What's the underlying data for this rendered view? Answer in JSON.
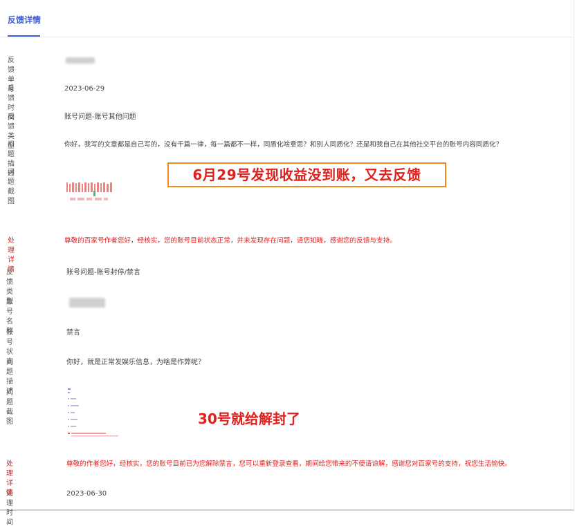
{
  "tab": {
    "label": "反馈详情"
  },
  "record1": {
    "id_label": "反馈单号",
    "time_label": "反馈时间",
    "time_value": "2023-06-29",
    "type_label": "反馈类型",
    "type_value": "账号问题-账号其他问题",
    "desc_label": "问题描述",
    "desc_value": "你好，我写的文章都是自己写的，没有千篇一律，每一篇都不一样，同质化啥意思？和别人同质化？还是和我自己在其他社交平台的账号内容同质化？",
    "screenshot_label": "问题截图",
    "detail_label": "处理详情",
    "detail_value": "尊敬的百家号作者您好，经核实，您的账号目前状态正常，并未发现存在问题，请您知晓，感谢您的反馈与支持。"
  },
  "record2": {
    "type_label": "反馈类型",
    "type_value": "账号问题-账号封停/禁言",
    "account_label": "账号名称",
    "status_label": "账号状态",
    "status_value": "禁言",
    "desc_label": "问题描述",
    "desc_value": "你好，就是正常发娱乐信息，为啥是作弊呢？",
    "screenshot_label": "问题截图",
    "detail_label": "处理详情",
    "detail_value": "尊敬的作者您好，经核实，您的账号目前已为您解除禁言，您可以重新登录查看，期间给您带来的不便请谅解，感谢您对百家号的支持，祝您生活愉快。",
    "processed_label": "处理时间",
    "processed_value": "2023-06-30"
  },
  "annotations": {
    "first": "6月29号发现收益没到账，又去反馈",
    "second": "30号就给解封了"
  },
  "colors": {
    "accent": "#3a5ed8",
    "alert_red": "#e02020",
    "annotation_border": "#f08a1c"
  }
}
